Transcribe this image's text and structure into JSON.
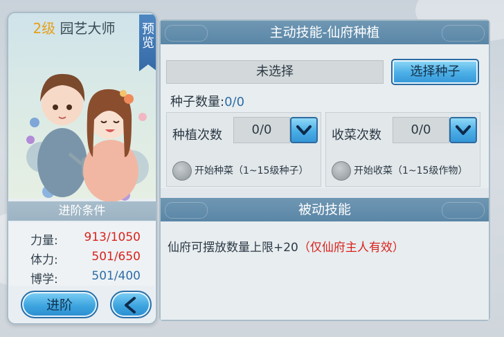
{
  "card": {
    "level": "2级",
    "title": "园艺大师",
    "preview_label": "预览",
    "conditions_header": "进阶条件",
    "stats": [
      {
        "label": "力量:",
        "value": "913/1050"
      },
      {
        "label": "体力:",
        "value": "501/650"
      },
      {
        "label": "博学:",
        "value": "501/400"
      }
    ],
    "advance_label": "进阶",
    "back_icon": "chevron-left-icon"
  },
  "active_skill": {
    "title": "主动技能-仙府种植",
    "selection_value": "未选择",
    "select_seed_label": "选择种子",
    "seed_count_label": "种子数量:",
    "seed_count_value": "0/0",
    "planting": {
      "label": "种植次数",
      "value": "0/0",
      "radio_label": "开始种菜（1~15级种子）"
    },
    "harvest": {
      "label": "收菜次数",
      "value": "0/0",
      "radio_label": "开始收菜（1~15级作物）"
    }
  },
  "passive_skill": {
    "title": "被动技能",
    "text": "仙府可摆放数量上限+20",
    "note": "（仅仙府主人有效）"
  },
  "colors": {
    "accent_blue": "#3ea5e0",
    "header_blue": "#5a86a6",
    "stat_red": "#d8231b",
    "stat_blue": "#2d6da6",
    "level_gold": "#e6a01a"
  }
}
